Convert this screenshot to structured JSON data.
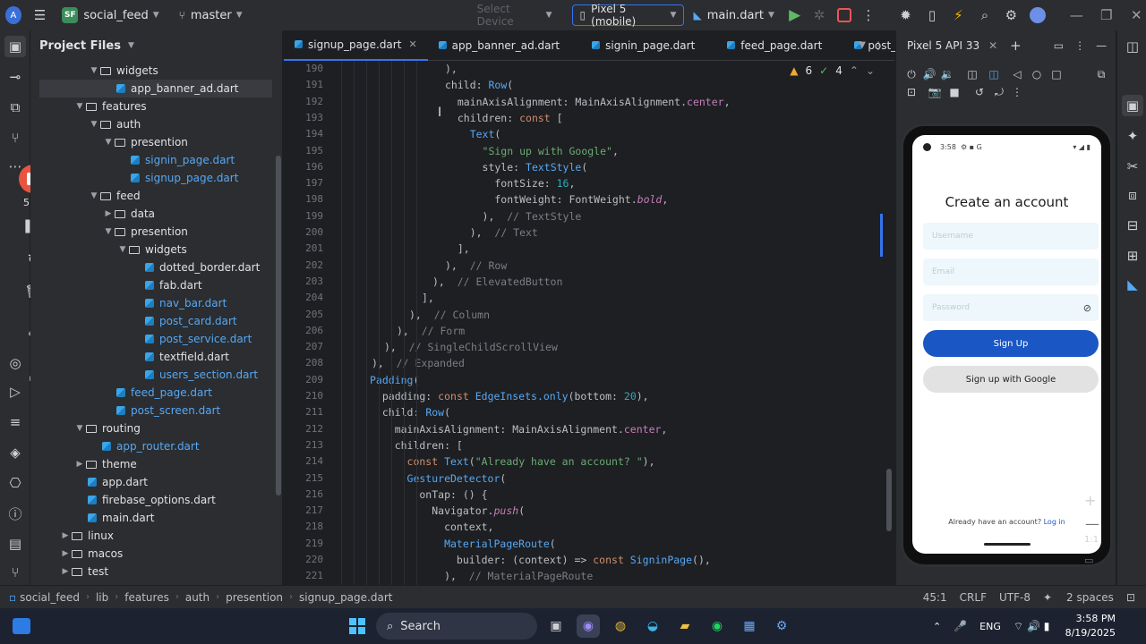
{
  "titlebar": {
    "project_badge": "SF",
    "project": "social_feed",
    "branch": "master",
    "device_placeholder": "Select Device",
    "device": "Pixel 5 (mobile)",
    "run_config": "main.dart"
  },
  "left_strip": {
    "timer": "5:00"
  },
  "project_panel": {
    "title": "Project Files",
    "tree": [
      {
        "label": "widgets",
        "type": "folder",
        "indent": 4,
        "open": true
      },
      {
        "label": "app_banner_ad.dart",
        "type": "dart",
        "indent": 6,
        "selected": true
      },
      {
        "label": "features",
        "type": "folder",
        "indent": 3,
        "open": true
      },
      {
        "label": "auth",
        "type": "folder",
        "indent": 4,
        "open": true
      },
      {
        "label": "presention",
        "type": "folder",
        "indent": 5,
        "open": true
      },
      {
        "label": "signin_page.dart",
        "type": "dart",
        "indent": 7,
        "blue": true
      },
      {
        "label": "signup_page.dart",
        "type": "dart",
        "indent": 7,
        "blue": true
      },
      {
        "label": "feed",
        "type": "folder",
        "indent": 4,
        "open": true
      },
      {
        "label": "data",
        "type": "folder",
        "indent": 5,
        "open": false
      },
      {
        "label": "presention",
        "type": "folder",
        "indent": 5,
        "open": true
      },
      {
        "label": "widgets",
        "type": "folder",
        "indent": 6,
        "open": true
      },
      {
        "label": "dotted_border.dart",
        "type": "dart",
        "indent": 8
      },
      {
        "label": "fab.dart",
        "type": "dart",
        "indent": 8
      },
      {
        "label": "nav_bar.dart",
        "type": "dart",
        "indent": 8,
        "blue": true
      },
      {
        "label": "post_card.dart",
        "type": "dart",
        "indent": 8,
        "blue": true
      },
      {
        "label": "post_service.dart",
        "type": "dart",
        "indent": 8,
        "blue": true
      },
      {
        "label": "textfield.dart",
        "type": "dart",
        "indent": 8
      },
      {
        "label": "users_section.dart",
        "type": "dart",
        "indent": 8,
        "blue": true
      },
      {
        "label": "feed_page.dart",
        "type": "dart",
        "indent": 6,
        "blue": true
      },
      {
        "label": "post_screen.dart",
        "type": "dart",
        "indent": 6,
        "blue": true
      },
      {
        "label": "routing",
        "type": "folder",
        "indent": 3,
        "open": true
      },
      {
        "label": "app_router.dart",
        "type": "dart",
        "indent": 5,
        "blue": true
      },
      {
        "label": "theme",
        "type": "folder",
        "indent": 3,
        "open": false
      },
      {
        "label": "app.dart",
        "type": "dart",
        "indent": 4
      },
      {
        "label": "firebase_options.dart",
        "type": "dart",
        "indent": 4
      },
      {
        "label": "main.dart",
        "type": "dart",
        "indent": 4
      },
      {
        "label": "linux",
        "type": "folder",
        "indent": 2,
        "open": false
      },
      {
        "label": "macos",
        "type": "folder",
        "indent": 2,
        "open": false
      },
      {
        "label": "test",
        "type": "folder",
        "indent": 2,
        "open": false
      }
    ]
  },
  "editor": {
    "tabs": [
      {
        "label": "signup_page.dart",
        "active": true
      },
      {
        "label": "app_banner_ad.dart"
      },
      {
        "label": "signin_page.dart"
      },
      {
        "label": "feed_page.dart"
      },
      {
        "label": "post_sc"
      }
    ],
    "inspections": {
      "warnings": "6",
      "ok": "4"
    },
    "lines": [
      {
        "n": "190",
        "html": "<span class='w'>),</span>"
      },
      {
        "n": "191",
        "html": "<span class='w'>child: </span><span class='f'>Row</span><span class='w'>(</span>"
      },
      {
        "n": "192",
        "html": "<span class='w'>  mainAxisAlignment: MainAxisAlignment.</span><span class='p'>center</span><span class='w'>,</span>"
      },
      {
        "n": "193",
        "html": "<span class='w'>  children: </span><span class='k'>const</span><span class='w'> [</span>"
      },
      {
        "n": "194",
        "html": "<span class='f'>    Text</span><span class='w'>(</span>"
      },
      {
        "n": "195",
        "html": "<span class='s'>      \"Sign up with Google\"</span><span class='w'>,</span>"
      },
      {
        "n": "196",
        "html": "<span class='w'>      style: </span><span class='f'>TextStyle</span><span class='w'>(</span>"
      },
      {
        "n": "197",
        "html": "<span class='w'>        fontSize: </span><span class='n'>16</span><span class='w'>,</span>"
      },
      {
        "n": "198",
        "html": "<span class='w'>        fontWeight: FontWeight.</span><span class='i'>bold</span><span class='w'>,</span>"
      },
      {
        "n": "199",
        "html": "<span class='w'>      ),  </span><span class='c'>// TextStyle</span>"
      },
      {
        "n": "200",
        "html": "<span class='w'>    ),  </span><span class='c'>// Text</span>"
      },
      {
        "n": "201",
        "html": "<span class='w'>  ],</span>"
      },
      {
        "n": "202",
        "html": "<span class='w'>),  </span><span class='c'>// Row</span>"
      },
      {
        "n": "203",
        "html": "<span class='w'>),  </span><span class='c'>// ElevatedButton</span>"
      },
      {
        "n": "204",
        "html": "<span class='w'>],</span>"
      },
      {
        "n": "205",
        "html": "<span class='w'>),  </span><span class='c'>// Column</span>"
      },
      {
        "n": "206",
        "html": "<span class='w'>),  </span><span class='c'>// Form</span>"
      },
      {
        "n": "207",
        "html": "<span class='w'>),  </span><span class='c'>// SingleChildScrollView</span>"
      },
      {
        "n": "208",
        "html": "<span class='w'>),  </span><span class='c'>// Expanded</span>"
      },
      {
        "n": "209",
        "html": "<span class='f'>Padding</span><span class='w'>(</span>"
      },
      {
        "n": "210",
        "html": "<span class='w'>  padding: </span><span class='k'>const</span><span class='f'> EdgeInsets.only</span><span class='w'>(bottom: </span><span class='n'>20</span><span class='w'>),</span>"
      },
      {
        "n": "211",
        "html": "<span class='w'>  child: </span><span class='f'>Row</span><span class='w'>(</span>"
      },
      {
        "n": "212",
        "html": "<span class='w'>    mainAxisAlignment: MainAxisAlignment.</span><span class='p'>center</span><span class='w'>,</span>"
      },
      {
        "n": "213",
        "html": "<span class='w'>    children: [</span>"
      },
      {
        "n": "214",
        "html": "<span class='k'>      const</span><span class='f'> Text</span><span class='w'>(</span><span class='s'>\"Already have an account? \"</span><span class='w'>),</span>"
      },
      {
        "n": "215",
        "html": "<span class='f'>      GestureDetector</span><span class='w'>(</span>"
      },
      {
        "n": "216",
        "html": "<span class='w'>        onTap: () {</span>"
      },
      {
        "n": "217",
        "html": "<span class='w'>          Navigator.</span><span class='i'>push</span><span class='w'>(</span>"
      },
      {
        "n": "218",
        "html": "<span class='w'>            context,</span>"
      },
      {
        "n": "219",
        "html": "<span class='f'>            MaterialPageRoute</span><span class='w'>(</span>"
      },
      {
        "n": "220",
        "html": "<span class='w'>              builder: (context) => </span><span class='k'>const</span><span class='f'> SigninPage</span><span class='w'>(),</span>"
      },
      {
        "n": "221",
        "html": "<span class='w'>            ),  </span><span class='c'>// MaterialPageRoute</span>"
      }
    ]
  },
  "emulator": {
    "title": "Pixel 5 API 33",
    "status_time": "3:58",
    "app_title": "Create an account",
    "username_ph": "Username",
    "email_ph": "Email",
    "password_ph": "Password",
    "signup": "Sign Up",
    "google": "Sign up with Google",
    "already": "Already have an account?",
    "login": "Log in",
    "zoom": "1:1"
  },
  "statusbar": {
    "crumbs": [
      "social_feed",
      "lib",
      "features",
      "auth",
      "presention",
      "signup_page.dart"
    ],
    "position": "45:1",
    "line_ending": "CRLF",
    "encoding": "UTF-8",
    "indent": "2 spaces"
  },
  "taskbar": {
    "search": "Search",
    "lang": "ENG",
    "time": "3:58 PM",
    "date": "8/19/2025"
  }
}
